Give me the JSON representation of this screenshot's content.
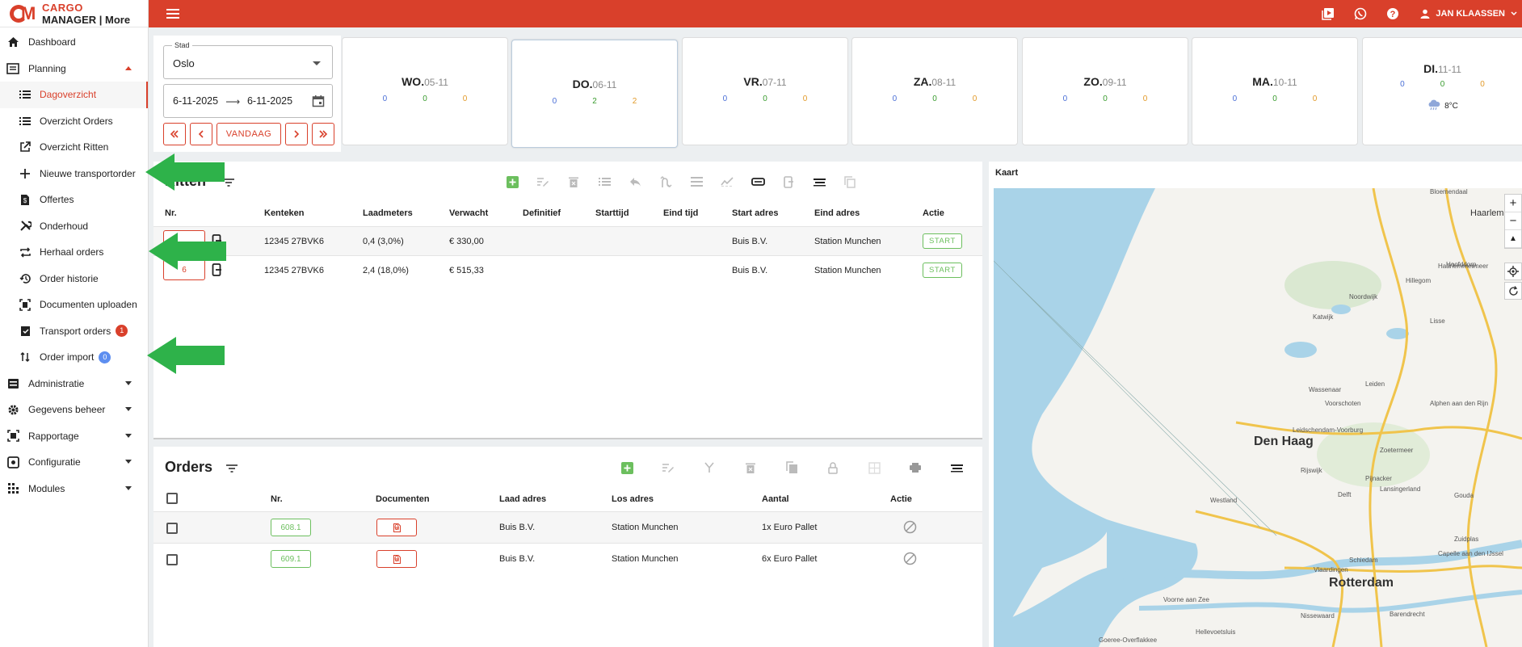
{
  "app": {
    "logo_line1": "CARGO",
    "logo_line2": "MANAGER | More"
  },
  "topbar": {
    "user_name": "JAN KLAASSEN"
  },
  "sidebar": {
    "items": [
      {
        "label": "Dashboard"
      },
      {
        "label": "Planning"
      },
      {
        "label": "Dagoverzicht"
      },
      {
        "label": "Overzicht Orders"
      },
      {
        "label": "Overzicht Ritten"
      },
      {
        "label": "Nieuwe transportorder"
      },
      {
        "label": "Offertes"
      },
      {
        "label": "Onderhoud"
      },
      {
        "label": "Herhaal orders"
      },
      {
        "label": "Order historie"
      },
      {
        "label": "Documenten uploaden"
      },
      {
        "label": "Transport orders",
        "badge": "1"
      },
      {
        "label": "Order import",
        "badge": "0"
      },
      {
        "label": "Administratie"
      },
      {
        "label": "Gegevens beheer"
      },
      {
        "label": "Rapportage"
      },
      {
        "label": "Configuratie"
      },
      {
        "label": "Modules"
      }
    ]
  },
  "filter": {
    "city_label": "Stad",
    "city_value": "Oslo",
    "date_from": "6-11-2025",
    "date_arrow": "⟶",
    "date_to": "6-11-2025",
    "today_label": "VANDAAG"
  },
  "days": [
    {
      "name": "WO.",
      "date": "05-11",
      "blue": "0",
      "green": "0",
      "orange": "0"
    },
    {
      "name": "DO.",
      "date": "06-11",
      "blue": "0",
      "green": "2",
      "orange": "2"
    },
    {
      "name": "VR.",
      "date": "07-11",
      "blue": "0",
      "green": "0",
      "orange": "0"
    },
    {
      "name": "ZA.",
      "date": "08-11",
      "blue": "0",
      "green": "0",
      "orange": "0"
    },
    {
      "name": "ZO.",
      "date": "09-11",
      "blue": "0",
      "green": "0",
      "orange": "0"
    },
    {
      "name": "MA.",
      "date": "10-11",
      "blue": "0",
      "green": "0",
      "orange": "0"
    },
    {
      "name": "DI.",
      "date": "11-11",
      "blue": "0",
      "green": "0",
      "orange": "0",
      "temp": "8°C"
    }
  ],
  "ritten": {
    "title": "Ritten",
    "headers": [
      "Nr.",
      "Kenteken",
      "Laadmeters",
      "Verwacht",
      "Definitief",
      "Starttijd",
      "Eind tijd",
      "Start adres",
      "Eind adres",
      "Actie"
    ],
    "rows": [
      {
        "nr": "",
        "kenteken": "12345 27BVK6",
        "laadmeters": "0,4 (3,0%)",
        "verwacht": "€ 330,00",
        "start": "Buis B.V.",
        "eind": "Station Munchen",
        "actie": "START"
      },
      {
        "nr": "6",
        "kenteken": "12345 27BVK6",
        "laadmeters": "2,4 (18,0%)",
        "verwacht": "€ 515,33",
        "start": "Buis B.V.",
        "eind": "Station Munchen",
        "actie": "START"
      }
    ]
  },
  "orders": {
    "title": "Orders",
    "headers": [
      "Nr.",
      "Documenten",
      "Laad adres",
      "Los adres",
      "Aantal",
      "Actie"
    ],
    "rows": [
      {
        "nr": "608.1",
        "docs": "0",
        "laad": "Buis B.V.",
        "los": "Station Munchen",
        "aantal": "1x Euro Pallet"
      },
      {
        "nr": "609.1",
        "docs": "0",
        "laad": "Buis B.V.",
        "los": "Station Munchen",
        "aantal": "6x Euro Pallet"
      }
    ]
  },
  "kaart": {
    "title": "Kaart",
    "cities": [
      "Den Haag",
      "Rotterdam"
    ],
    "labels": [
      "Haarlem",
      "Bloemendaal",
      "Hoofddorp",
      "Katwijk",
      "Leiden",
      "Wassenaar",
      "Voorschoten",
      "Zoetermeer",
      "Delft",
      "Alphen aan den Rijn",
      "Gouda",
      "Westland",
      "Vlaardingen",
      "Schiedam",
      "Capelle aan den IJssel",
      "Barendrecht",
      "Hellevoetsluis",
      "Nissewaard",
      "Voorne aan Zee",
      "Lisse",
      "Haarlemmermeer",
      "Leidschendam-Voorburg",
      "Rijswijk",
      "Pijnacker",
      "Lansingerland",
      "Hillegom",
      "Noordwijk",
      "Zuidplas",
      "Goeree-Overflakkee"
    ]
  }
}
